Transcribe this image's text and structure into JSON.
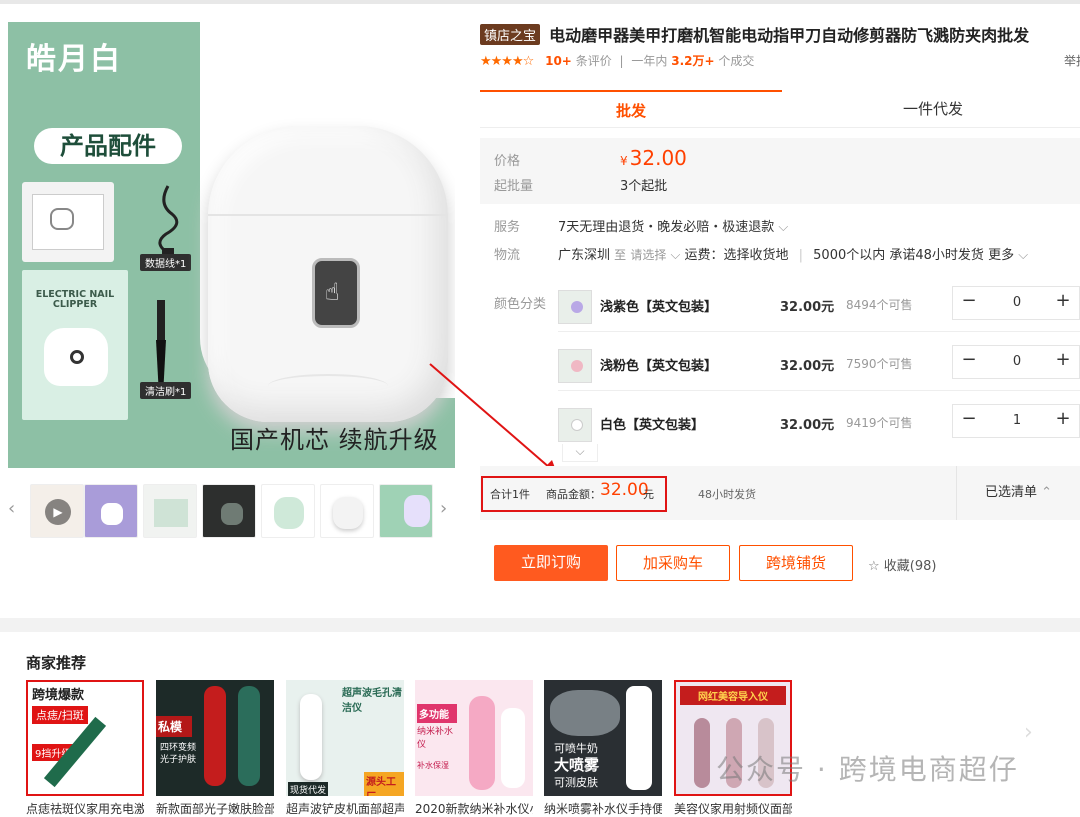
{
  "gallery": {
    "brand": "皓月白",
    "accessories_title": "产品配件",
    "cable_label": "数据线*1",
    "brush_label": "清洁刷*1",
    "card_text": "ELECTRIC NAIL CLIPPER",
    "slogan": "国产机芯 续航升级",
    "prev_icon": "chevron-left-icon",
    "next_icon": "chevron-right-icon"
  },
  "product": {
    "badge": "镇店之宝",
    "title": "电动磨甲器美甲打磨机智能电动指甲刀自动修剪器防飞溅防夹肉批发",
    "rating_stars": 4.5,
    "reviews_count": "10+",
    "reviews_label": "条评价",
    "sold_prefix": "一年内",
    "sold_count": "3.2万+",
    "sold_suffix": "个成交",
    "cut_text": "举报"
  },
  "tabs": [
    {
      "label": "批发",
      "active": true
    },
    {
      "label": "一件代发",
      "active": false
    }
  ],
  "pricing": {
    "price_label": "价格",
    "currency": "¥",
    "price": "32.00",
    "moq_label": "起批量",
    "moq": "3个起批"
  },
  "service": {
    "label": "服务",
    "value": "7天无理由退货・晚发必赔・极速退款"
  },
  "logistics": {
    "label": "物流",
    "origin": "广东深圳",
    "to": "至",
    "select": "请选择",
    "fee": "运费：选择收货地",
    "promise": "5000个以内 承诺48小时发货",
    "more": "更多"
  },
  "sku_label": "颜色分类",
  "skus": [
    {
      "name": "浅紫色【英文包装】",
      "price": "32.00元",
      "stock": "8494个可售",
      "qty": "0",
      "dot": "#b9a8e6"
    },
    {
      "name": "浅粉色【英文包装】",
      "price": "32.00元",
      "stock": "7590个可售",
      "qty": "0",
      "dot": "#f0b8c4"
    },
    {
      "name": "白色【英文包装】",
      "price": "32.00元",
      "stock": "9419个可售",
      "qty": "1",
      "dot": "#ffffff"
    }
  ],
  "totals": {
    "count": "合计1件",
    "amount_label": "商品金额：",
    "amount": "32.00",
    "unit": "元",
    "ship": "48小时发货",
    "selected": "已选清单"
  },
  "actions": {
    "order": "立即订购",
    "add_cart": "加采购车",
    "cross_border": "跨境铺货",
    "favorite": "收藏(98)"
  },
  "recommend": {
    "title": "商家推荐",
    "items": [
      {
        "caption": "点痣祛斑仪家用充电激",
        "badge_top": "跨境爆款",
        "badge_mid": "点痣/扫斑",
        "badge_low": "9挡升级"
      },
      {
        "caption": "新款面部光子嫩肤脸部",
        "badge_top": "私模",
        "badge_mid": "四环变频",
        "badge_low": "光子护肤"
      },
      {
        "caption": "超声波铲皮机面部超声",
        "badge_top": "超声波毛孔清洁仪",
        "badge_mid": "源头工厂",
        "badge_low": "现货代发"
      },
      {
        "caption": "2020新款纳米补水仪小",
        "badge_top": "多功能",
        "badge_mid": "纳米补水仪",
        "badge_low": "补水保湿"
      },
      {
        "caption": "纳米喷雾补水仪手持便",
        "badge_top": "可喷牛奶",
        "badge_mid": "大喷雾",
        "badge_low": "可测皮肤"
      },
      {
        "caption": "美容仪家用射频仪面部",
        "badge_top": "网红美容导入仪",
        "badge_mid": "",
        "badge_low": ""
      }
    ]
  },
  "watermark": "公众号 · 跨境电商超仔",
  "colors": {
    "accent": "#ff5000",
    "price": "#ff4000",
    "highlight_box": "#e01414",
    "gallery_bg": "#8dc0a5"
  }
}
